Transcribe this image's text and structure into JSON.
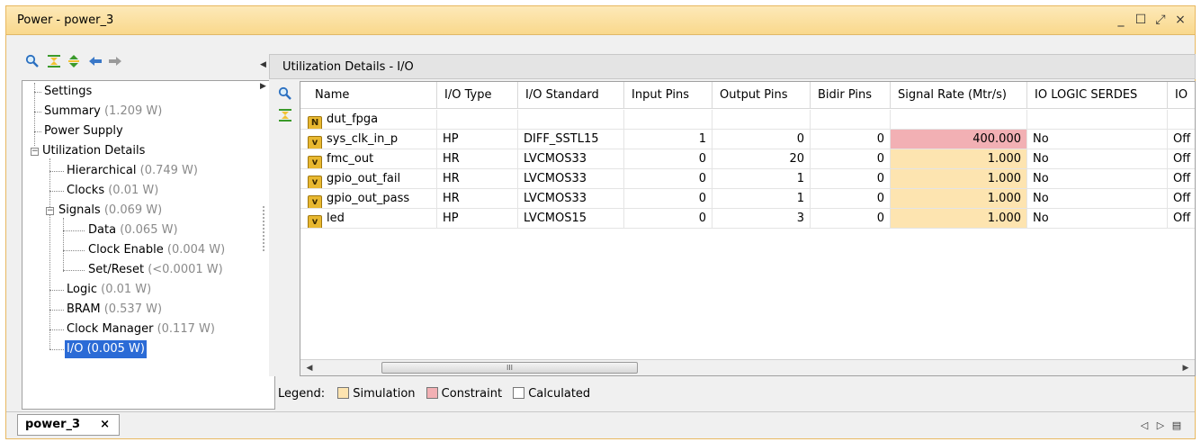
{
  "window": {
    "title": "Power - power_3",
    "controls": [
      "_",
      "☐",
      "⤢",
      "×"
    ]
  },
  "left_toolbar_icons": [
    "search-icon",
    "collapse-all-icon",
    "expand-all-icon",
    "back-arrow-icon",
    "forward-arrow-icon"
  ],
  "tree": [
    {
      "label": "Settings",
      "value": ""
    },
    {
      "label": "Summary",
      "value": "(1.209 W)"
    },
    {
      "label": "Power Supply",
      "value": ""
    },
    {
      "label": "Utilization Details",
      "value": ""
    },
    {
      "label": "Hierarchical",
      "value": "(0.749 W)"
    },
    {
      "label": "Clocks",
      "value": "(0.01 W)"
    },
    {
      "label": "Signals",
      "value": "(0.069 W)"
    },
    {
      "label": "Data",
      "value": "(0.065 W)"
    },
    {
      "label": "Clock Enable",
      "value": "(0.004 W)"
    },
    {
      "label": "Set/Reset",
      "value": "(<0.0001 W)"
    },
    {
      "label": "Logic",
      "value": "(0.01 W)"
    },
    {
      "label": "BRAM",
      "value": "(0.537 W)"
    },
    {
      "label": "Clock Manager",
      "value": "(0.117 W)"
    },
    {
      "label": "I/O",
      "value": "(0.005 W)",
      "selected": true
    }
  ],
  "details": {
    "title": "Utilization Details - I/O",
    "columns": [
      "Name",
      "I/O Type",
      "I/O Standard",
      "Input Pins",
      "Output Pins",
      "Bidir Pins",
      "Signal Rate (Mtr/s)",
      "IO LOGIC SERDES",
      "IO"
    ],
    "rows": [
      {
        "name": "dut_fpga",
        "icon": "N",
        "io_type": "",
        "io_standard": "",
        "input": "",
        "output": "",
        "bidir": "",
        "rate": "",
        "rate_source": "",
        "serdes": "",
        "io": ""
      },
      {
        "name": "sys_clk_in_p",
        "icon": "v",
        "io_type": "HP",
        "io_standard": "DIFF_SSTL15",
        "input": "1",
        "output": "0",
        "bidir": "0",
        "rate": "400.000",
        "rate_source": "constraint",
        "serdes": "No",
        "io": "Off"
      },
      {
        "name": "fmc_out",
        "icon": "v",
        "io_type": "HR",
        "io_standard": "LVCMOS33",
        "input": "0",
        "output": "20",
        "bidir": "0",
        "rate": "1.000",
        "rate_source": "simulation",
        "serdes": "No",
        "io": "Off"
      },
      {
        "name": "gpio_out_fail",
        "icon": "v",
        "io_type": "HR",
        "io_standard": "LVCMOS33",
        "input": "0",
        "output": "1",
        "bidir": "0",
        "rate": "1.000",
        "rate_source": "simulation",
        "serdes": "No",
        "io": "Off"
      },
      {
        "name": "gpio_out_pass",
        "icon": "v",
        "io_type": "HR",
        "io_standard": "LVCMOS33",
        "input": "0",
        "output": "1",
        "bidir": "0",
        "rate": "1.000",
        "rate_source": "simulation",
        "serdes": "No",
        "io": "Off"
      },
      {
        "name": "led",
        "icon": "v",
        "io_type": "HP",
        "io_standard": "LVCMOS15",
        "input": "0",
        "output": "3",
        "bidir": "0",
        "rate": "1.000",
        "rate_source": "simulation",
        "serdes": "No",
        "io": "Off"
      }
    ],
    "scrollbar_grip": "III"
  },
  "legend": {
    "label": "Legend:",
    "items": [
      {
        "label": "Simulation",
        "color": "#fde4b0"
      },
      {
        "label": "Constraint",
        "color": "#f2b0b4"
      },
      {
        "label": "Calculated",
        "color": "#ffffff"
      }
    ]
  },
  "bottom_tab": {
    "label": "power_3",
    "close": "×"
  },
  "nav": [
    "◁",
    "▷",
    "▤"
  ],
  "colors": {
    "title_bar": "#f9d88c",
    "selection": "#2b6bd6",
    "simulation": "#fde4b0",
    "constraint": "#f2b0b4"
  }
}
